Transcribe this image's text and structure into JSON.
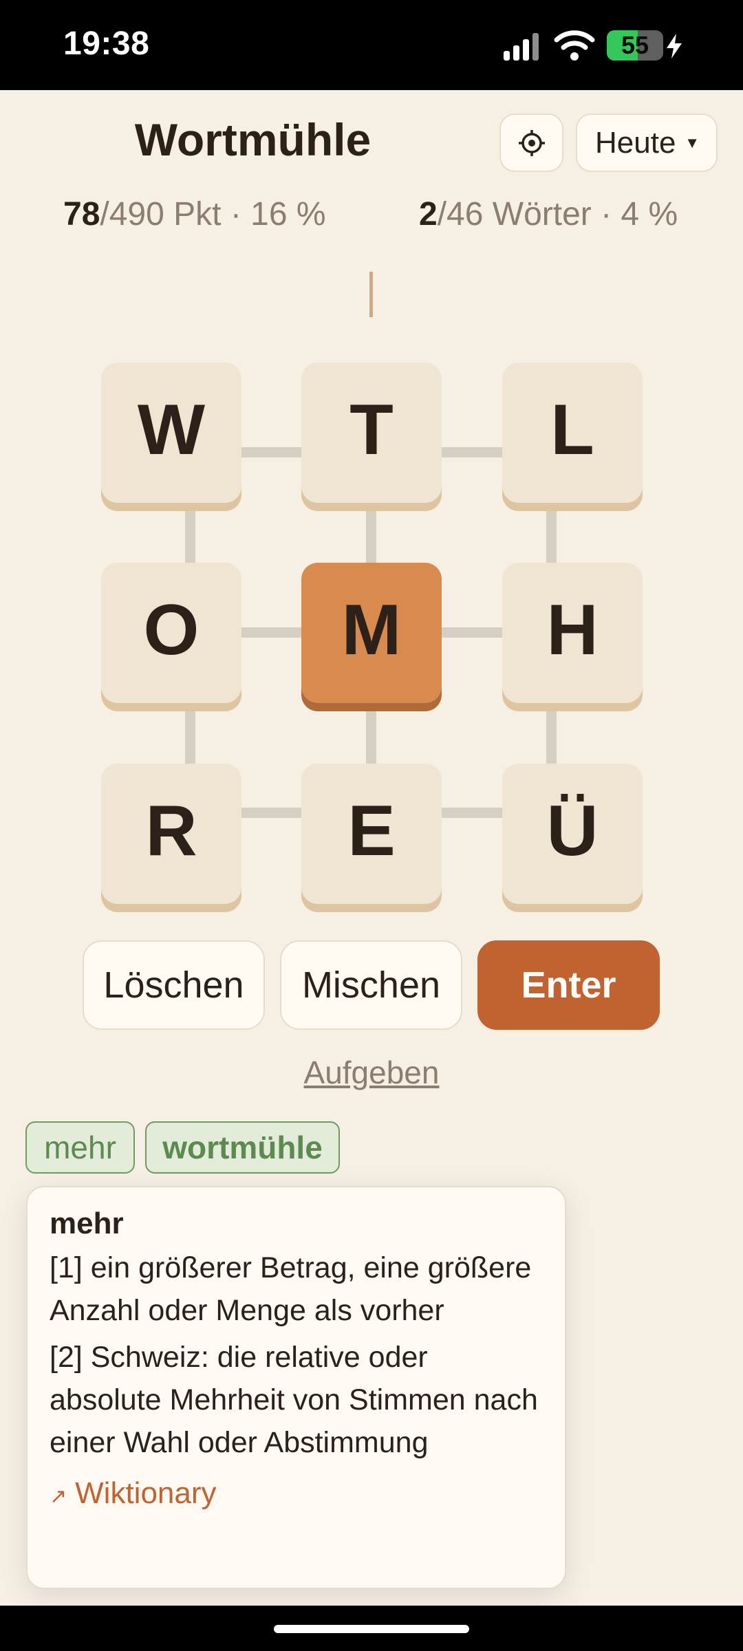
{
  "status_bar": {
    "time": "19:38",
    "battery": "55",
    "battery_level": 0.55
  },
  "header": {
    "title": "Wortmühle",
    "date_selector": "Heute"
  },
  "progress": {
    "points_current": "78",
    "points_rest": "/490 Pkt · 16 %",
    "words_current": "2",
    "words_rest": "/46 Wörter · 4 %"
  },
  "board": {
    "letters": [
      "W",
      "T",
      "L",
      "O",
      "M",
      "H",
      "R",
      "E",
      "Ü"
    ],
    "center_letter": "M"
  },
  "actions": {
    "delete": "Löschen",
    "shuffle": "Mischen",
    "enter": "Enter",
    "give_up": "Aufgeben"
  },
  "found_words": [
    "mehr",
    "wortmühle"
  ],
  "definition": {
    "word": "mehr",
    "senses": [
      "[1] ein größerer Betrag, eine größere Anzahl oder Menge als vorher",
      "[2] Schweiz: die relative oder absolute Mehrheit von Stimmen nach einer Wahl oder Abstimmung"
    ],
    "link_label": "Wiktionary"
  },
  "colors": {
    "accent": "#c16231",
    "center_tile": "#d98a4e",
    "tile": "#f0e5d3",
    "background": "#f5efe4",
    "found_word": "#5d8a50"
  }
}
